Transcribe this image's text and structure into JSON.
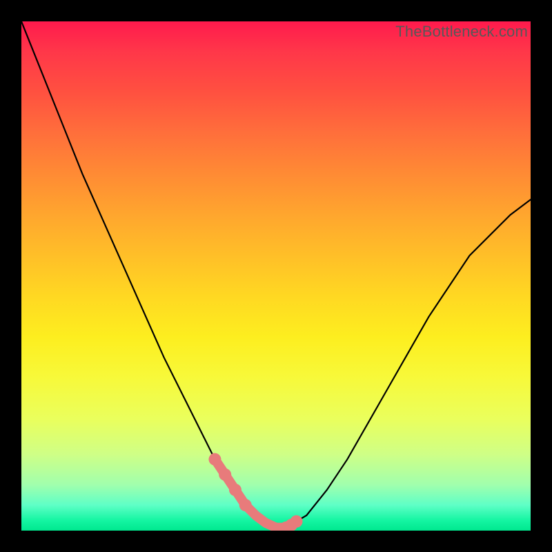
{
  "watermark": "TheBottleneck.com",
  "colors": {
    "pink_highlight": "#e87b7b",
    "curve": "#000000"
  },
  "chart_data": {
    "type": "line",
    "title": "",
    "xlabel": "",
    "ylabel": "",
    "xlim": [
      0,
      100
    ],
    "ylim": [
      0,
      100
    ],
    "grid": false,
    "series": [
      {
        "name": "bottleneck-curve",
        "x": [
          0,
          4,
          8,
          12,
          16,
          20,
          24,
          28,
          30,
          32,
          34,
          36,
          38,
          40,
          42,
          44,
          46,
          48,
          50,
          52,
          56,
          60,
          64,
          68,
          72,
          76,
          80,
          84,
          88,
          92,
          96,
          100
        ],
        "y": [
          100,
          90,
          80,
          70,
          61,
          52,
          43,
          34,
          30,
          26,
          22,
          18,
          14,
          11,
          8,
          5,
          3,
          1.5,
          0.6,
          0.6,
          3,
          8,
          14,
          21,
          28,
          35,
          42,
          48,
          54,
          58,
          62,
          65
        ]
      }
    ],
    "highlight": {
      "name": "optimal-range",
      "x": [
        38,
        40,
        42,
        44,
        46,
        48,
        50,
        52,
        54
      ],
      "y": [
        14,
        11,
        8,
        5,
        3,
        1.5,
        0.6,
        0.6,
        1.8
      ],
      "dots_x": [
        38,
        40,
        42,
        44,
        52,
        53,
        54
      ],
      "dots_y": [
        14,
        11,
        8,
        5,
        0.6,
        1.1,
        1.8
      ]
    }
  }
}
